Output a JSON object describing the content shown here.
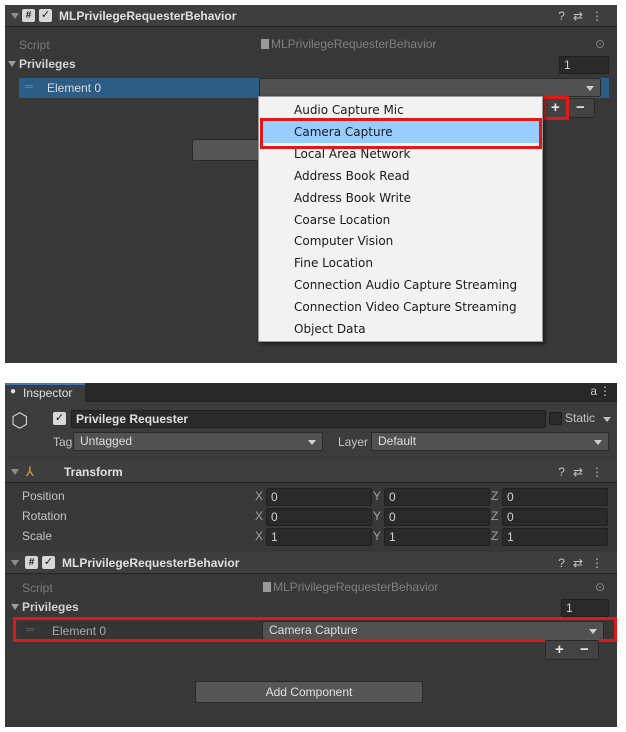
{
  "top": {
    "component": {
      "title": "MLPrivilegeRequesterBehavior",
      "script_label": "Script",
      "script_value": "MLPrivilegeRequesterBehavior",
      "privileges_label": "Privileges",
      "privileges_count": "1",
      "element_label": "Element 0",
      "element_value": ""
    },
    "popup_items": [
      "Audio Capture Mic",
      "Camera Capture",
      "Local Area Network",
      "Address Book Read",
      "Address Book Write",
      "Coarse Location",
      "Computer Vision",
      "Fine Location",
      "Connection Audio Capture Streaming",
      "Connection Video Capture Streaming",
      "Object Data"
    ],
    "selected_index": 1
  },
  "bottom": {
    "tab_label": "Inspector",
    "object_name": "Privilege Requester",
    "static_label": "Static",
    "tag_label": "Tag",
    "tag_value": "Untagged",
    "layer_label": "Layer",
    "layer_value": "Default",
    "transform": {
      "title": "Transform",
      "rows": [
        {
          "label": "Position",
          "x": "0",
          "y": "0",
          "z": "0"
        },
        {
          "label": "Rotation",
          "x": "0",
          "y": "0",
          "z": "0"
        },
        {
          "label": "Scale",
          "x": "1",
          "y": "1",
          "z": "1"
        }
      ]
    },
    "component": {
      "title": "MLPrivilegeRequesterBehavior",
      "script_label": "Script",
      "script_value": "MLPrivilegeRequesterBehavior",
      "privileges_label": "Privileges",
      "privileges_count": "1",
      "element_label": "Element 0",
      "element_value": "Camera Capture"
    },
    "add_component_label": "Add Component"
  },
  "axis_labels": {
    "x": "X",
    "y": "Y",
    "z": "Z"
  },
  "icons": {
    "help": "?",
    "settings": "⇄",
    "more": "⋮",
    "lock": "a",
    "plus": "+",
    "minus": "−",
    "check": "✓",
    "hash": "#",
    "target": "⊙"
  },
  "colors": {
    "highlight": "#e01818",
    "selected_row": "#2c5d87",
    "menu_selected": "#99ccff"
  }
}
